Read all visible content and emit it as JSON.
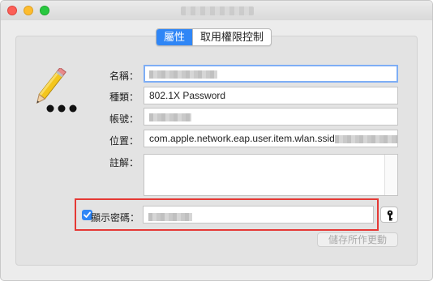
{
  "window": {
    "title": ""
  },
  "tabs": [
    {
      "label": "屬性",
      "active": true
    },
    {
      "label": "取用權限控制",
      "active": false
    }
  ],
  "form": {
    "name_label": "名稱：",
    "name_value": "",
    "kind_label": "種類：",
    "kind_value": "802.1X Password",
    "account_label": "帳號：",
    "account_value": "",
    "where_label": "位置：",
    "where_value": "com.apple.network.eap.user.item.wlan.ssid",
    "comments_label": "註解：",
    "comments_value": "",
    "show_password_label": "顯示密碼：",
    "show_password_checked": true,
    "password_value": "",
    "save_button_label": "儲存所作更動"
  },
  "colors": {
    "accent": "#2f86f6",
    "highlight_border": "#e53935"
  },
  "icons": {
    "app_icon": "pencil-icon",
    "key_button": "key-icon"
  }
}
